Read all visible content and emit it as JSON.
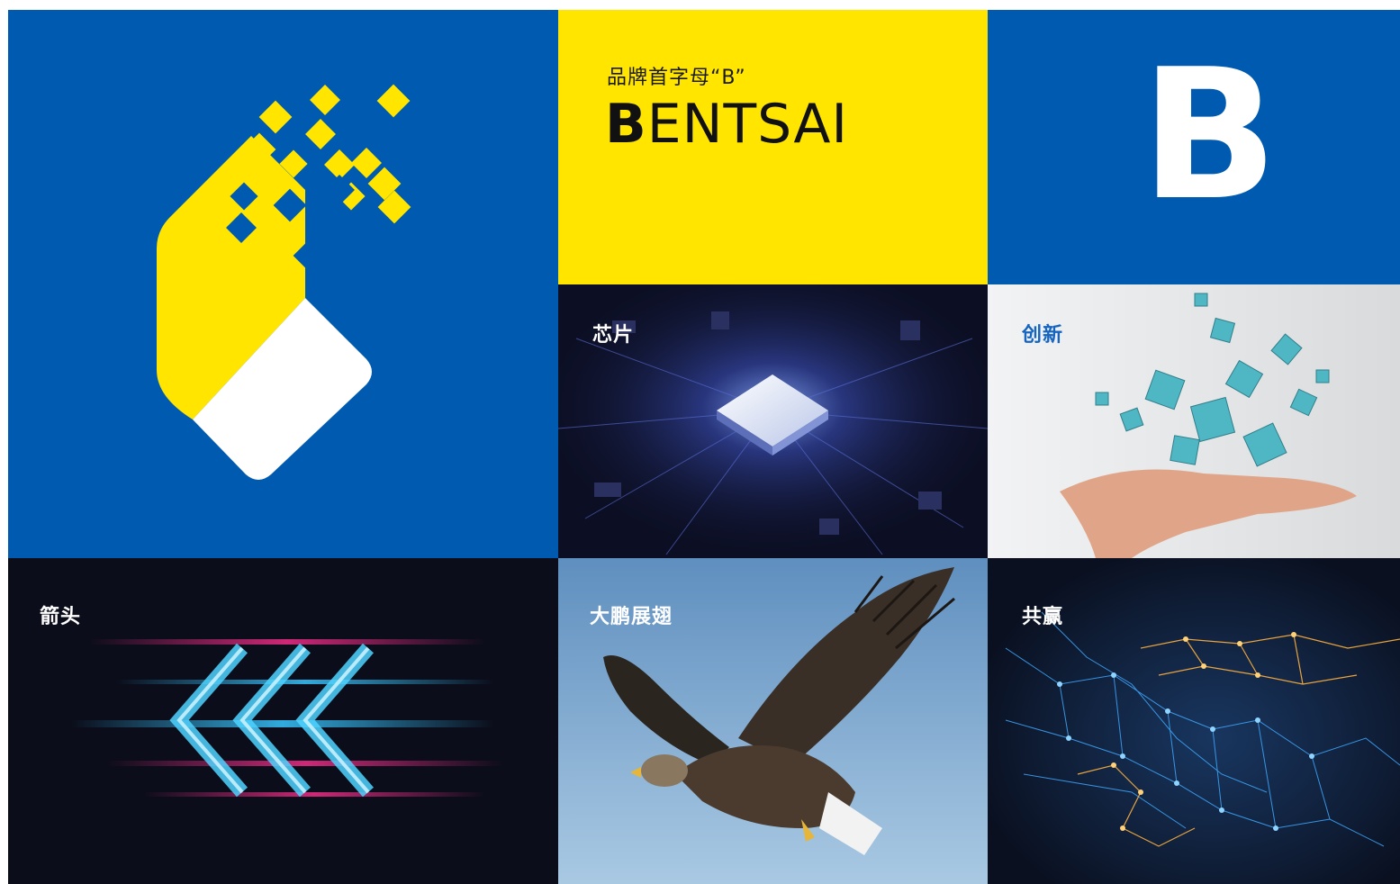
{
  "brand": {
    "subtitle": "品牌首字母“B”",
    "name_first_letter": "B",
    "name_rest": "ENTSAI",
    "big_letter": "B"
  },
  "tiles": {
    "chip": "芯片",
    "innovation": "创新",
    "arrow": "箭头",
    "eagle": "大鹏展翅",
    "win_win": "共赢"
  },
  "colors": {
    "brand_blue": "#005bb0",
    "brand_yellow": "#ffe500",
    "white": "#ffffff",
    "innovation_label": "#1565c0"
  },
  "icons": [
    "pixel-hand-logo-icon",
    "circuit-chip-image",
    "floating-cubes-hand-image",
    "light-arrows-image",
    "eagle-image",
    "network-handshake-image"
  ]
}
